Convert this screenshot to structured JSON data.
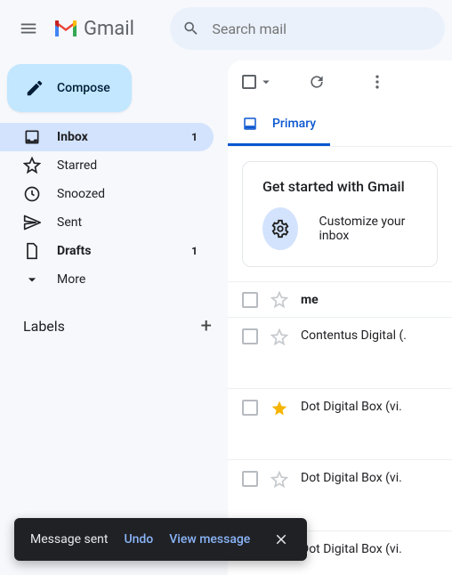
{
  "header": {
    "product": "Gmail",
    "search_placeholder": "Search mail"
  },
  "compose_label": "Compose",
  "nav": [
    {
      "icon": "inbox",
      "label": "Inbox",
      "count": "1",
      "active": true,
      "bold": true
    },
    {
      "icon": "star",
      "label": "Starred"
    },
    {
      "icon": "clock",
      "label": "Snoozed"
    },
    {
      "icon": "send",
      "label": "Sent"
    },
    {
      "icon": "file",
      "label": "Drafts",
      "count": "1",
      "bold": true
    },
    {
      "icon": "chevron-down",
      "label": "More"
    }
  ],
  "labels_heading": "Labels",
  "tabs": {
    "primary": "Primary"
  },
  "getstarted": {
    "title": "Get started with Gmail",
    "item": "Customize your inbox"
  },
  "emails": [
    {
      "sender": "me",
      "bold": true,
      "starred": false
    },
    {
      "sender": "Contentus Digital (.",
      "starred": false,
      "tall": true
    },
    {
      "sender": "Dot Digital Box (vi.",
      "starred": true,
      "tall": true
    },
    {
      "sender": "Dot Digital Box (vi.",
      "starred": false,
      "tall": true
    },
    {
      "sender": "Dot Digital Box (vi.",
      "starred": false
    }
  ],
  "toast": {
    "message": "Message sent",
    "undo": "Undo",
    "view": "View message"
  }
}
